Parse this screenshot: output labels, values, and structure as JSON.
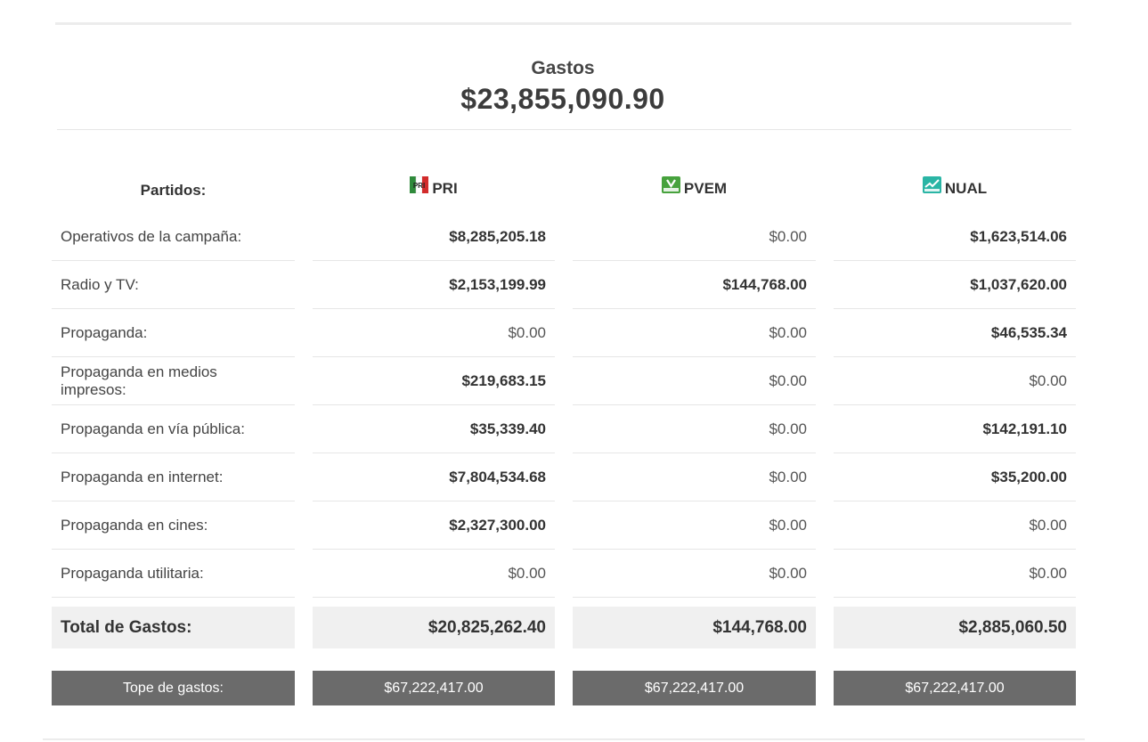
{
  "summary": {
    "title": "Gastos",
    "total": "$23,855,090.90"
  },
  "table": {
    "header_label": "Partidos:",
    "parties": [
      {
        "name": "PRI",
        "icon": "pri-logo-icon",
        "colors": [
          "#2f8a3b",
          "#ffffff",
          "#d22b2b"
        ]
      },
      {
        "name": "PVEM",
        "icon": "pvem-logo-icon",
        "colors": [
          "#47a23d"
        ]
      },
      {
        "name": "NUAL",
        "icon": "nual-logo-icon",
        "colors": [
          "#2ab5a5"
        ]
      }
    ],
    "rows": [
      {
        "label": "Operativos de la campaña:",
        "values": [
          "$8,285,205.18",
          "$0.00",
          "$1,623,514.06"
        ]
      },
      {
        "label": "Radio y TV:",
        "values": [
          "$2,153,199.99",
          "$144,768.00",
          "$1,037,620.00"
        ]
      },
      {
        "label": "Propaganda:",
        "values": [
          "$0.00",
          "$0.00",
          "$46,535.34"
        ]
      },
      {
        "label": "Propaganda en medios impresos:",
        "values": [
          "$219,683.15",
          "$0.00",
          "$0.00"
        ]
      },
      {
        "label": "Propaganda en vía pública:",
        "values": [
          "$35,339.40",
          "$0.00",
          "$142,191.10"
        ]
      },
      {
        "label": "Propaganda en internet:",
        "values": [
          "$7,804,534.68",
          "$0.00",
          "$35,200.00"
        ]
      },
      {
        "label": "Propaganda en cines:",
        "values": [
          "$2,327,300.00",
          "$0.00",
          "$0.00"
        ]
      },
      {
        "label": "Propaganda utilitaria:",
        "values": [
          "$0.00",
          "$0.00",
          "$0.00"
        ]
      }
    ],
    "total": {
      "label": "Total de Gastos:",
      "values": [
        "$20,825,262.40",
        "$144,768.00",
        "$2,885,060.50"
      ]
    },
    "tope": {
      "label": "Tope de gastos:",
      "values": [
        "$67,222,417.00",
        "$67,222,417.00",
        "$67,222,417.00"
      ]
    }
  }
}
